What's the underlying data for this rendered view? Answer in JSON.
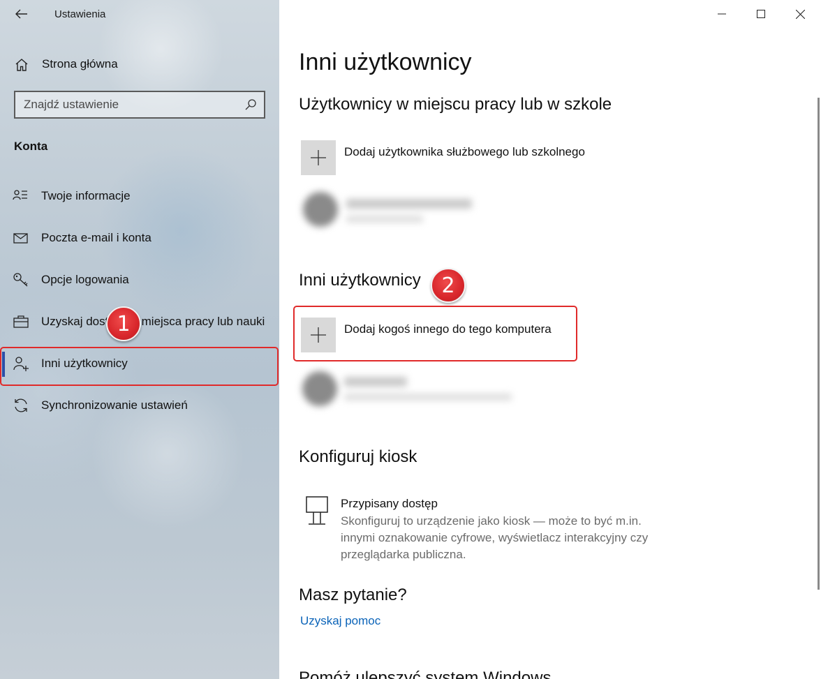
{
  "window": {
    "title": "Ustawienia",
    "controls": [
      "minimize",
      "maximize",
      "close"
    ]
  },
  "sidebar": {
    "home_label": "Strona główna",
    "search_placeholder": "Znajdź ustawienie",
    "section_label": "Konta",
    "items": [
      {
        "label": "Twoje informacje",
        "icon": "person-info-icon"
      },
      {
        "label": "Poczta e-mail i konta",
        "icon": "mail-icon"
      },
      {
        "label": "Opcje logowania",
        "icon": "key-icon"
      },
      {
        "label": "Uzyskaj dostęp do miejsca pracy lub nauki",
        "icon": "briefcase-icon"
      },
      {
        "label": "Inni użytkownicy",
        "icon": "add-person-icon",
        "active": true
      },
      {
        "label": "Synchronizowanie ustawień",
        "icon": "sync-icon"
      }
    ]
  },
  "annotations": {
    "badge1": "1",
    "badge2": "2",
    "color": "#d8262b"
  },
  "main": {
    "title": "Inni użytkownicy",
    "work_section": {
      "heading": "Użytkownicy w miejscu pracy lub w szkole",
      "add_label": "Dodaj użytkownika służbowego lub szkolnego"
    },
    "other_section": {
      "heading": "Inni użytkownicy",
      "add_label": "Dodaj kogoś innego do tego komputera"
    },
    "kiosk_section": {
      "heading": "Konfiguruj kiosk",
      "item_title": "Przypisany dostęp",
      "item_desc": "Skonfiguruj to urządzenie jako kiosk — może to być m.in. innymi oznakowanie cyfrowe, wyświetlacz interakcyjny czy przeglądarka publiczna."
    },
    "help_section": {
      "heading": "Masz pytanie?",
      "link": "Uzyskaj pomoc"
    },
    "cut_heading": "Pomóż ulepszyć system Windows"
  },
  "colors": {
    "accent_link": "#0a63b8",
    "active_bar": "#2b4fa8",
    "annotation_red": "#e02a2a"
  }
}
